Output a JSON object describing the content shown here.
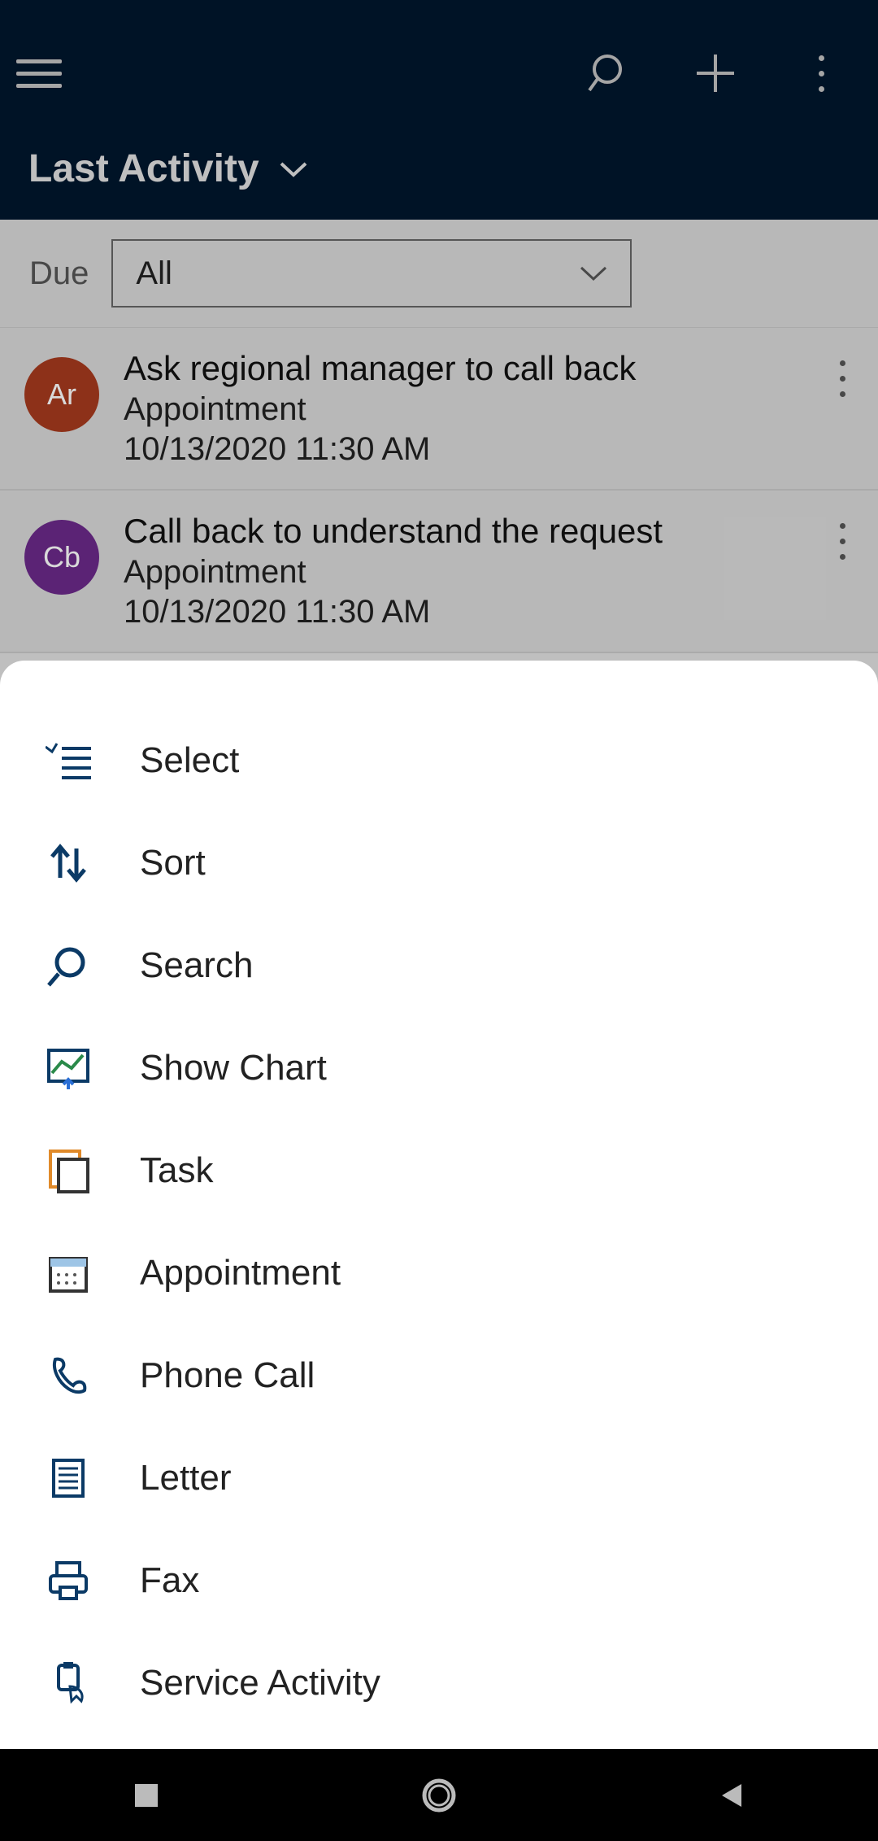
{
  "header": {
    "title": "Last Activity"
  },
  "filter": {
    "label": "Due",
    "value": "All"
  },
  "rows": [
    {
      "avatar_text": "Ar",
      "avatar_color": "#a63a1e",
      "title": "Ask regional manager to call back",
      "type": "Appointment",
      "date": "10/13/2020 11:30 AM"
    },
    {
      "avatar_text": "Cb",
      "avatar_color": "#6b2a8a",
      "title": "Call back to understand the request",
      "type": "Appointment",
      "date": "10/13/2020 11:30 AM"
    }
  ],
  "sheet": {
    "items": [
      {
        "label": "Select",
        "icon": "select"
      },
      {
        "label": "Sort",
        "icon": "sort"
      },
      {
        "label": "Search",
        "icon": "search"
      },
      {
        "label": "Show Chart",
        "icon": "chart"
      },
      {
        "label": "Task",
        "icon": "task"
      },
      {
        "label": "Appointment",
        "icon": "calendar"
      },
      {
        "label": "Phone Call",
        "icon": "phone"
      },
      {
        "label": "Letter",
        "icon": "letter"
      },
      {
        "label": "Fax",
        "icon": "fax"
      },
      {
        "label": "Service Activity",
        "icon": "service"
      }
    ]
  }
}
